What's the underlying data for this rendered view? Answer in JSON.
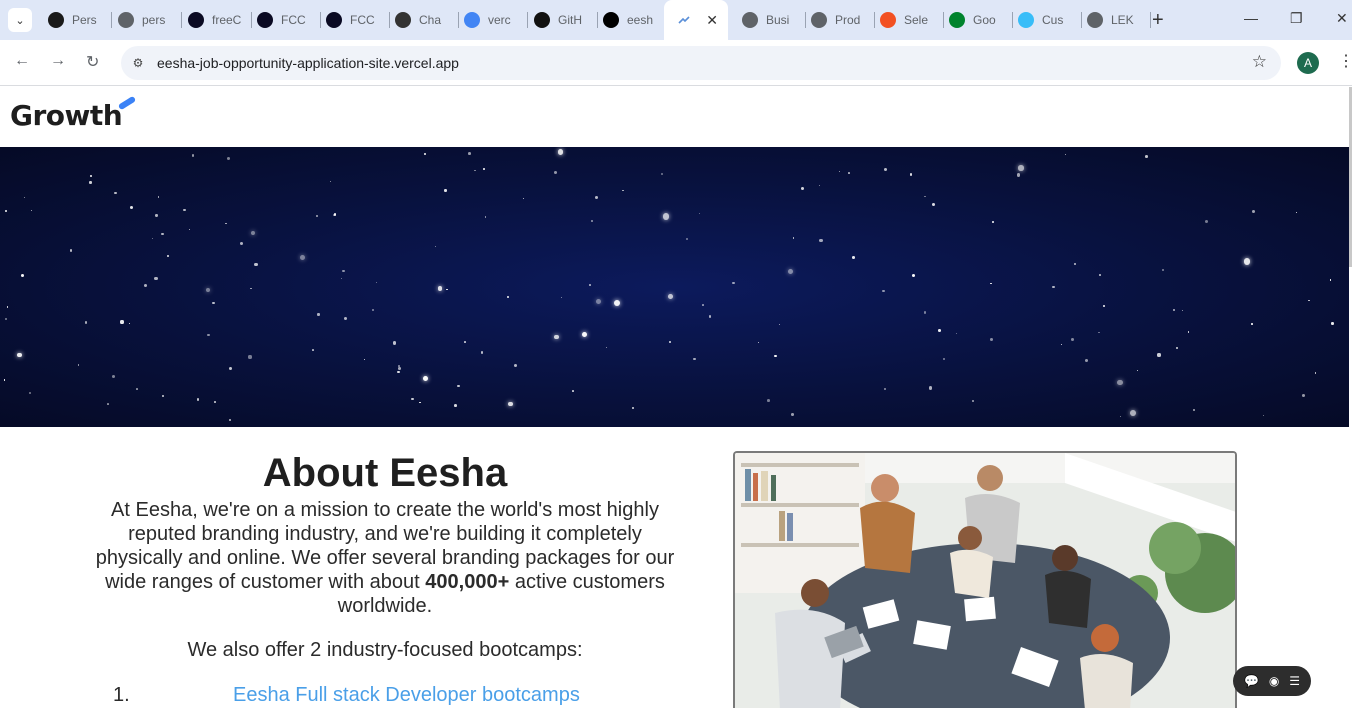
{
  "browser": {
    "tabs": [
      {
        "label": "Pers",
        "icon": "brand-a-icon",
        "color": "#1a1a1a"
      },
      {
        "label": "pers",
        "icon": "globe-icon",
        "color": "#5f6368"
      },
      {
        "label": "freeC",
        "icon": "freecodecamp-icon",
        "color": "#0a0a23"
      },
      {
        "label": "FCC",
        "icon": "freecodecamp-icon",
        "color": "#0a0a23"
      },
      {
        "label": "FCC",
        "icon": "freecodecamp-icon",
        "color": "#0a0a23"
      },
      {
        "label": "Cha",
        "icon": "chatgpt-icon",
        "color": "#333333"
      },
      {
        "label": "verc",
        "icon": "google-icon",
        "color": "#4285f4"
      },
      {
        "label": "GitH",
        "icon": "github-icon",
        "color": "#111111"
      },
      {
        "label": "eesh",
        "icon": "vercel-icon",
        "color": "#000000"
      },
      {
        "label": "Busi",
        "icon": "globe-icon",
        "color": "#5f6368"
      },
      {
        "label": "Prod",
        "icon": "globe-icon",
        "color": "#5f6368"
      },
      {
        "label": "Sele",
        "icon": "microsoft-icon",
        "color": "#f25022"
      },
      {
        "label": "Goo",
        "icon": "google-meet-icon",
        "color": "#00832d"
      },
      {
        "label": "Cus",
        "icon": "tailwind-icon",
        "color": "#38bdf8"
      },
      {
        "label": "LEK",
        "icon": "globe-icon",
        "color": "#5f6368"
      }
    ],
    "active_tab_icon": "growth-favicon-icon",
    "url": "eesha-job-opportunity-application-site.vercel.app",
    "profile_initial": "A"
  },
  "site": {
    "brand": "Growth",
    "about": {
      "title": "About Eesha",
      "p1_before": "At Eesha, we're on a mission to create the world's most highly reputed branding industry, and we're building it completely physically and online. We offer several branding packages for our wide ranges of customer with about ",
      "p1_bold": "400,000+",
      "p1_after": " active customers worldwide.",
      "p2": "We also offer 2 industry-focused bootcamps:"
    },
    "bootcamps": [
      {
        "num": "1.",
        "label": "Eesha Full stack Developer bootcamps"
      }
    ]
  },
  "colors": {
    "tabstrip": "#dfe7f7",
    "link": "#4a9fe8",
    "hero": "#08113d",
    "brand_accent": "#3b82f6"
  }
}
